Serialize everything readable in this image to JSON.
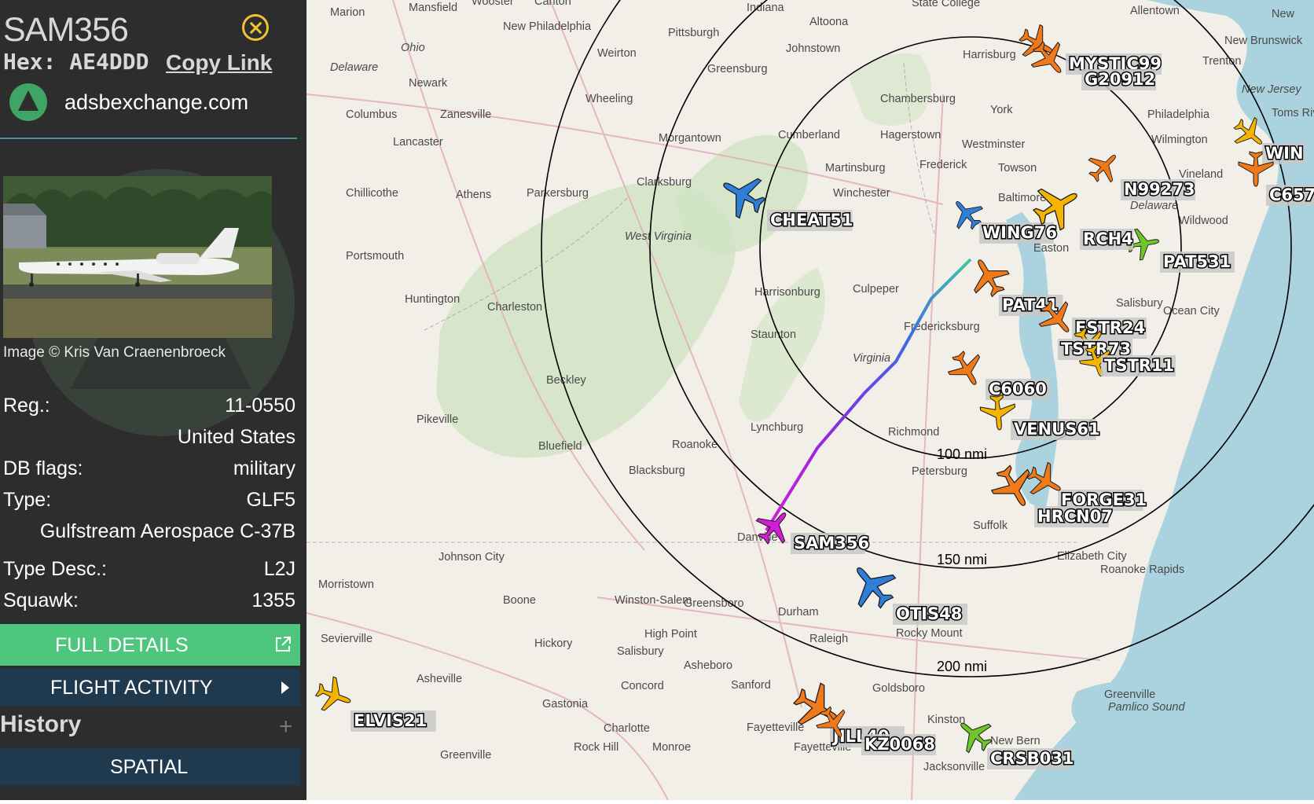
{
  "aircraft": {
    "callsign": "SAM356",
    "hex_label": "Hex:",
    "hex": "AE4DDD",
    "copy_link": "Copy Link",
    "site": "adsbexchange.com",
    "photo_credit": "Image © Kris Van Craenenbroeck",
    "reg_label": "Reg.:",
    "reg": "11-0550",
    "country": "United States",
    "dbflags_label": "DB flags:",
    "dbflags": "military",
    "type_label": "Type:",
    "type": "GLF5",
    "type_name": "Gulfstream Aerospace C-37B",
    "typedesc_label": "Type Desc.:",
    "typedesc": "L2J",
    "squawk_label": "Squawk:",
    "squawk": "1355"
  },
  "buttons": {
    "full_details": "FULL DETAILS",
    "flight_activity": "FLIGHT ACTIVITY",
    "history": "History",
    "spatial": "SPATIAL"
  },
  "map": {
    "cities": [
      "Marion",
      "Mansfield",
      "Wooster",
      "Canton",
      "Indiana",
      "Altoona",
      "State College",
      "Allentown",
      "New",
      "New Philadelphia",
      "Pittsburgh",
      "Johnstown",
      "Harrisburg",
      "New Brunswick",
      "Trenton",
      "Ohio",
      "Delaware",
      "Weirton",
      "Greensburg",
      "Newark",
      "Lancaster",
      "New Jersey",
      "Columbus",
      "Zanesville",
      "Wheeling",
      "Chambersburg",
      "York",
      "Philadelphia",
      "Toms River",
      "Morgantown",
      "Cumberland",
      "Hagerstown",
      "Westminster",
      "Wilmington",
      "Chillicothe",
      "Athens",
      "Parkersburg",
      "Clarksburg",
      "Martinsburg",
      "Frederick",
      "Towson",
      "Vineland",
      "Winchester",
      "Baltimore",
      "Delaware",
      "Wildwood",
      "Portsmouth",
      "West Virginia",
      "Easton",
      "Huntington",
      "Charleston",
      "Harrisonburg",
      "Culpeper",
      "Salisbury",
      "Ocean City",
      "Staunton",
      "Fredericksburg",
      "Virginia",
      "Beckley",
      "Pikeville",
      "Lynchburg",
      "Richmond",
      "Bluefield",
      "Roanoke",
      "Blacksburg",
      "Petersburg",
      "Suffolk",
      "Danville",
      "Johnson City",
      "Morristown",
      "Roanoke Rapids",
      "Elizabeth City",
      "Boone",
      "Winston-Salem",
      "Greensboro",
      "Durham",
      "Raleigh",
      "Rocky Mount",
      "Sevierville",
      "High Point",
      "Hickory",
      "Salisbury",
      "Asheboro",
      "Asheville",
      "Concord",
      "Sanford",
      "Goldsboro",
      "Greenville",
      "Pamlico Sound",
      "Gastonia",
      "Charlotte",
      "Kinston",
      "New Bern",
      "Rock Hill",
      "Monroe",
      "Fayetteville",
      "Greenville",
      "Jacksonville",
      "Fayetteville"
    ],
    "ring_labels": [
      "100 nmi",
      "150 nmi",
      "200 nmi"
    ],
    "aircraft_labels": [
      "CHEAT51",
      "WING76",
      "MYSTIC99",
      "G20912",
      "N99273",
      "RCH4",
      "PAT531",
      "PAT41",
      "ESTR24",
      "TSTR73",
      "TSTR11",
      "C6060",
      "VENUS61",
      "FORGE31",
      "HRCN07",
      "SAM356",
      "OTIS48",
      "ELVIS21",
      "JILL40",
      "KZ0068",
      "CRSB031",
      "WIN",
      "C657"
    ]
  },
  "colors": {
    "sidebar_bg": "#2d2d2d",
    "full_details_bg": "#4fc67e",
    "dark_button_bg": "#1f3a4f",
    "close_icon": "#f1c232",
    "aircraft_orange": "#f07a1a",
    "aircraft_yellow": "#f4b400",
    "aircraft_blue": "#2f7ed8",
    "aircraft_magenta": "#d11ed4",
    "aircraft_green": "#6ec62a"
  }
}
